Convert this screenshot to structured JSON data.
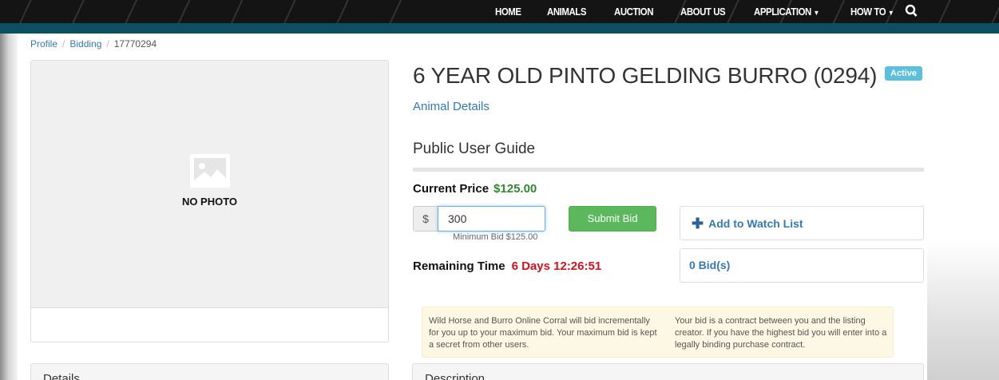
{
  "nav": {
    "items": [
      {
        "label": "HOME",
        "dropdown": false
      },
      {
        "label": "ANIMALS",
        "dropdown": false
      },
      {
        "label": "AUCTION",
        "dropdown": false
      },
      {
        "label": "ABOUT US",
        "dropdown": false
      },
      {
        "label": "APPLICATION",
        "dropdown": true
      },
      {
        "label": "HOW TO",
        "dropdown": true
      }
    ],
    "search_icon": "search-icon"
  },
  "breadcrumb": {
    "items": [
      "Profile",
      "Bidding",
      "17770294"
    ],
    "separator": "/"
  },
  "photo": {
    "placeholder_icon": "image-placeholder-icon",
    "no_photo_label": "NO PHOTO"
  },
  "listing": {
    "title": "6 YEAR OLD PINTO GELDING BURRO (0294)",
    "status": "Active",
    "animal_details_link": "Animal Details",
    "guide_title": "Public User Guide",
    "current_price_label": "Current Price",
    "current_price": "$125.00",
    "currency_symbol": "$",
    "bid_value": "300",
    "minimum_bid": "Minimum Bid $125.00",
    "submit_label": "Submit Bid",
    "watch_label": "Add to Watch List",
    "remaining_label": "Remaining Time",
    "remaining_time": "6 Days 12:26:51",
    "bids_count": "0 Bid(s)"
  },
  "notice": {
    "left": "Wild Horse and Burro Online Corral will bid incrementally for you up to your maximum bid. Your maximum bid is kept a secret from other users.",
    "right": "Your bid is a contract between you and the listing creator. If you have the highest bid you will enter into a legally binding purchase contract."
  },
  "panels": {
    "details": "Details",
    "description": "Description"
  },
  "colors": {
    "navbar": "#141414",
    "teal_bar": "#0c4f60",
    "price_green": "#2e8b2e",
    "time_red": "#d9101c",
    "submit_green": "#5cb85c",
    "badge_blue": "#5bc0de",
    "link_blue": "#337ab7"
  }
}
